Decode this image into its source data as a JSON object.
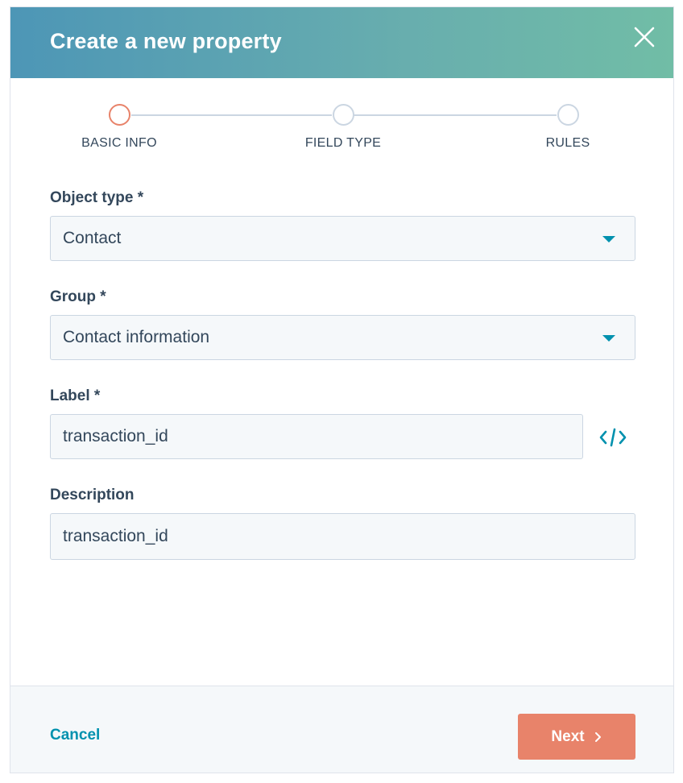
{
  "header": {
    "title": "Create a new property",
    "close_icon": "close-icon"
  },
  "steps": [
    {
      "label": "BASIC INFO",
      "active": true
    },
    {
      "label": "FIELD TYPE",
      "active": false
    },
    {
      "label": "RULES",
      "active": false
    }
  ],
  "form": {
    "object_type": {
      "label": "Object type *",
      "value": "Contact"
    },
    "group": {
      "label": "Group *",
      "value": "Contact information"
    },
    "label": {
      "label": "Label *",
      "value": "transaction_id",
      "icon": "code-icon"
    },
    "description": {
      "label": "Description",
      "value": "transaction_id"
    }
  },
  "footer": {
    "cancel_label": "Cancel",
    "next_label": "Next"
  },
  "colors": {
    "accent": "#e8836a",
    "link": "#0091ae",
    "header_gradient_start": "#4d96b6",
    "header_gradient_end": "#71bda6"
  }
}
